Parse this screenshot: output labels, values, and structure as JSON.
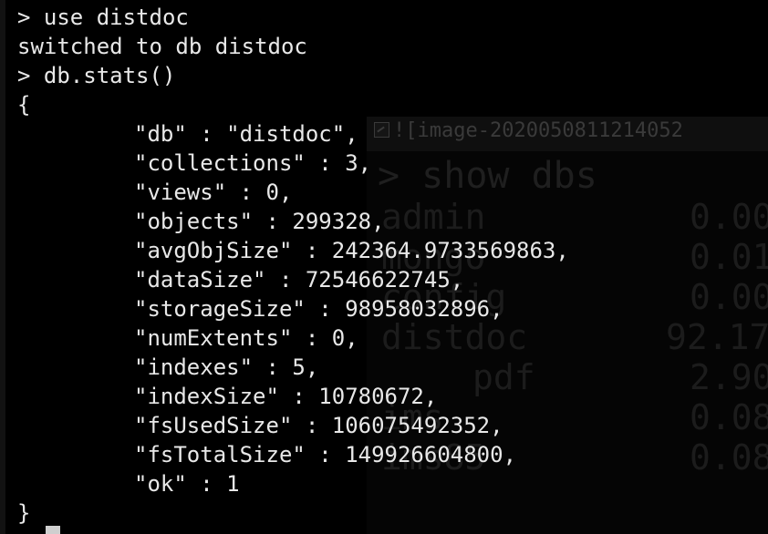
{
  "terminal": {
    "lines": [
      "> use distdoc",
      "switched to db distdoc",
      "> db.stats()",
      "{",
      "\"db\" : \"distdoc\",",
      "\"collections\" : 3,",
      "\"views\" : 0,",
      "\"objects\" : 299328,",
      "\"avgObjSize\" : 242364.9733569863,",
      "\"dataSize\" : 72546622745,",
      "\"storageSize\" : 98958032896,",
      "\"numExtents\" : 0,",
      "\"indexes\" : 5,",
      "\"indexSize\" : 10780672,",
      "\"fsUsedSize\" : 106075492352,",
      "\"fsTotalSize\" : 149926604800,",
      "\"ok\" : 1",
      "}"
    ]
  },
  "background_image": {
    "broken_link_text": "![image-2020050811214052",
    "command": "> show dbs",
    "rows": [
      {
        "name": "admin",
        "size": "0.00"
      },
      {
        "name": "mongo",
        "size": "0.01"
      },
      {
        "name": "config",
        "size": "0.00"
      },
      {
        "name": "distdoc",
        "size": "92.17"
      },
      {
        "name": "pdf",
        "size": "2.90"
      },
      {
        "name": "ims",
        "size": "0.08"
      },
      {
        "name": "ims85",
        "size": "0.08"
      }
    ]
  },
  "colors": {
    "background": "#000000",
    "text": "#e8e8e8",
    "background_overlay_text": "#1c1c1c"
  }
}
